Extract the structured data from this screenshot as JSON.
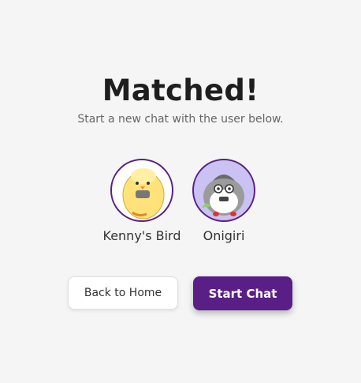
{
  "header": {
    "title": "Matched!",
    "subtitle": "Start a new chat with the user below."
  },
  "match": {
    "users": [
      {
        "name": "Kenny's Bird",
        "avatar": "yellow-bird-avatar"
      },
      {
        "name": "Onigiri",
        "avatar": "gray-bird-avatar"
      }
    ]
  },
  "actions": {
    "back_label": "Back to Home",
    "start_label": "Start Chat"
  },
  "colors": {
    "accent": "#5a1f86",
    "background": "#f5f5f5",
    "onigiri_avatar_bg": "#c9c2f2"
  }
}
